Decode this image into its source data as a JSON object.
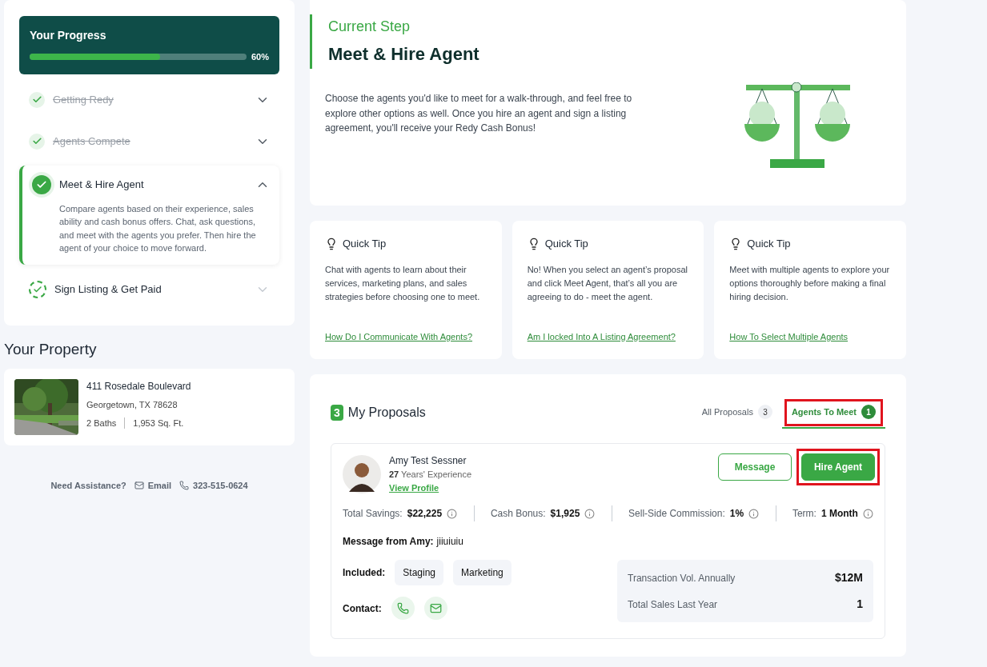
{
  "progress": {
    "title": "Your Progress",
    "level": 0.6,
    "percent": "60%"
  },
  "steps": [
    {
      "label": "Getting Redy",
      "kind": "done",
      "expanded": false
    },
    {
      "label": "Agents Compete",
      "kind": "done",
      "expanded": false
    },
    {
      "label": "Meet & Hire Agent",
      "kind": "current",
      "expanded": true,
      "description": "Compare agents based on their experience, sales ability and cash bonus offers. Chat, ask questions, and meet with the agents you prefer. Then hire the agent of your choice to move forward."
    },
    {
      "label": "Sign Listing & Get Paid",
      "kind": "pending",
      "expanded": false
    }
  ],
  "property": {
    "heading": "Your Property",
    "address": "411 Rosedale Boulevard",
    "city": "Georgetown, TX 78628",
    "baths": "2 Baths",
    "area": "1,953 Sq. Ft."
  },
  "assistance": {
    "label": "Need Assistance?",
    "email": "Email",
    "phone": "323-515-0624"
  },
  "current_step": {
    "eyebrow": "Current Step",
    "title": "Meet & Hire Agent",
    "text": "Choose the agents you'd like to meet for a walk-through, and feel free to explore other options as well. Once you hire an agent and sign a listing agreement, you'll receive your Redy Cash Bonus!"
  },
  "tips": [
    {
      "title": "Quick Tip",
      "text": "Chat with agents to learn about their services, marketing plans, and sales strategies before choosing one to meet.",
      "link": "How Do I Communicate With Agents?"
    },
    {
      "title": "Quick Tip",
      "text": "No! When you select an agent’s proposal and click Meet Agent, that’s all you are agreeing to do - meet the agent.",
      "link": "Am I locked Into A Listing Agreement?"
    },
    {
      "title": "Quick Tip",
      "text": "Meet with multiple agents to explore your options thoroughly before making a final hiring decision.",
      "link": "How To Select Multiple Agents"
    }
  ],
  "proposals": {
    "badge": "3",
    "title": "My Proposals",
    "tabs": [
      {
        "label": "All Proposals",
        "count": "3",
        "selected": false,
        "highlighted": false
      },
      {
        "label": "Agents To Meet",
        "count": "1",
        "selected": true,
        "highlighted": true
      }
    ],
    "agent": {
      "name": "Amy Test Sessner",
      "years": "27",
      "experience": "Years' Experience",
      "profile_link": "View Profile",
      "buttons": [
        {
          "label": "Message",
          "kind": "outline",
          "highlighted": false
        },
        {
          "label": "Hire Agent",
          "kind": "primary",
          "highlighted": true
        }
      ],
      "stats": [
        {
          "label": "Total Savings:",
          "value": "$22,225"
        },
        {
          "label": "Cash Bonus:",
          "value": "$1,925"
        },
        {
          "label": "Sell-Side Commission:",
          "value": "1%"
        },
        {
          "label": "Term:",
          "value": "1 Month"
        }
      ],
      "message_label": "Message from Amy:",
      "message": "jiiuiuiu",
      "included_label": "Included:",
      "included": [
        "Staging",
        "Marketing"
      ],
      "contact_label": "Contact:",
      "metrics": [
        {
          "label": "Transaction Vol. Annually",
          "value": "$12M"
        },
        {
          "label": "Total Sales Last Year",
          "value": "1"
        }
      ]
    }
  }
}
